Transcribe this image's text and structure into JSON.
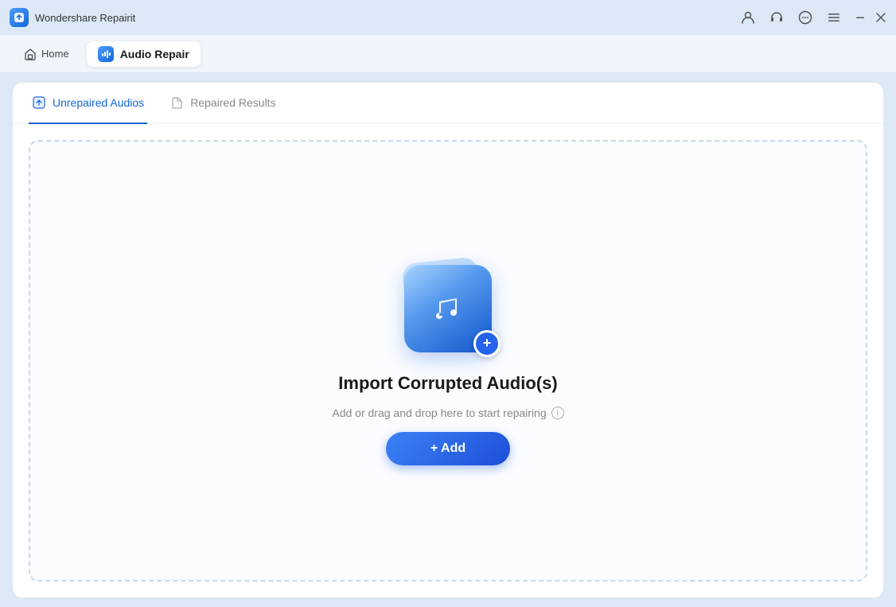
{
  "app": {
    "title": "Wondershare Repairit",
    "icon": "🔧"
  },
  "titlebar": {
    "icons": {
      "user": "user-icon",
      "headset": "headset-icon",
      "chat": "chat-icon",
      "menu": "menu-icon"
    },
    "window_controls": {
      "minimize": "−",
      "close": "✕"
    }
  },
  "nav": {
    "home_label": "Home",
    "active_tab_label": "Audio Repair"
  },
  "tabs": {
    "unrepaired_label": "Unrepaired Audios",
    "repaired_label": "Repaired Results"
  },
  "dropzone": {
    "title": "Import Corrupted Audio(s)",
    "subtitle": "Add or drag and drop here to start repairing",
    "add_button_label": "+ Add"
  }
}
